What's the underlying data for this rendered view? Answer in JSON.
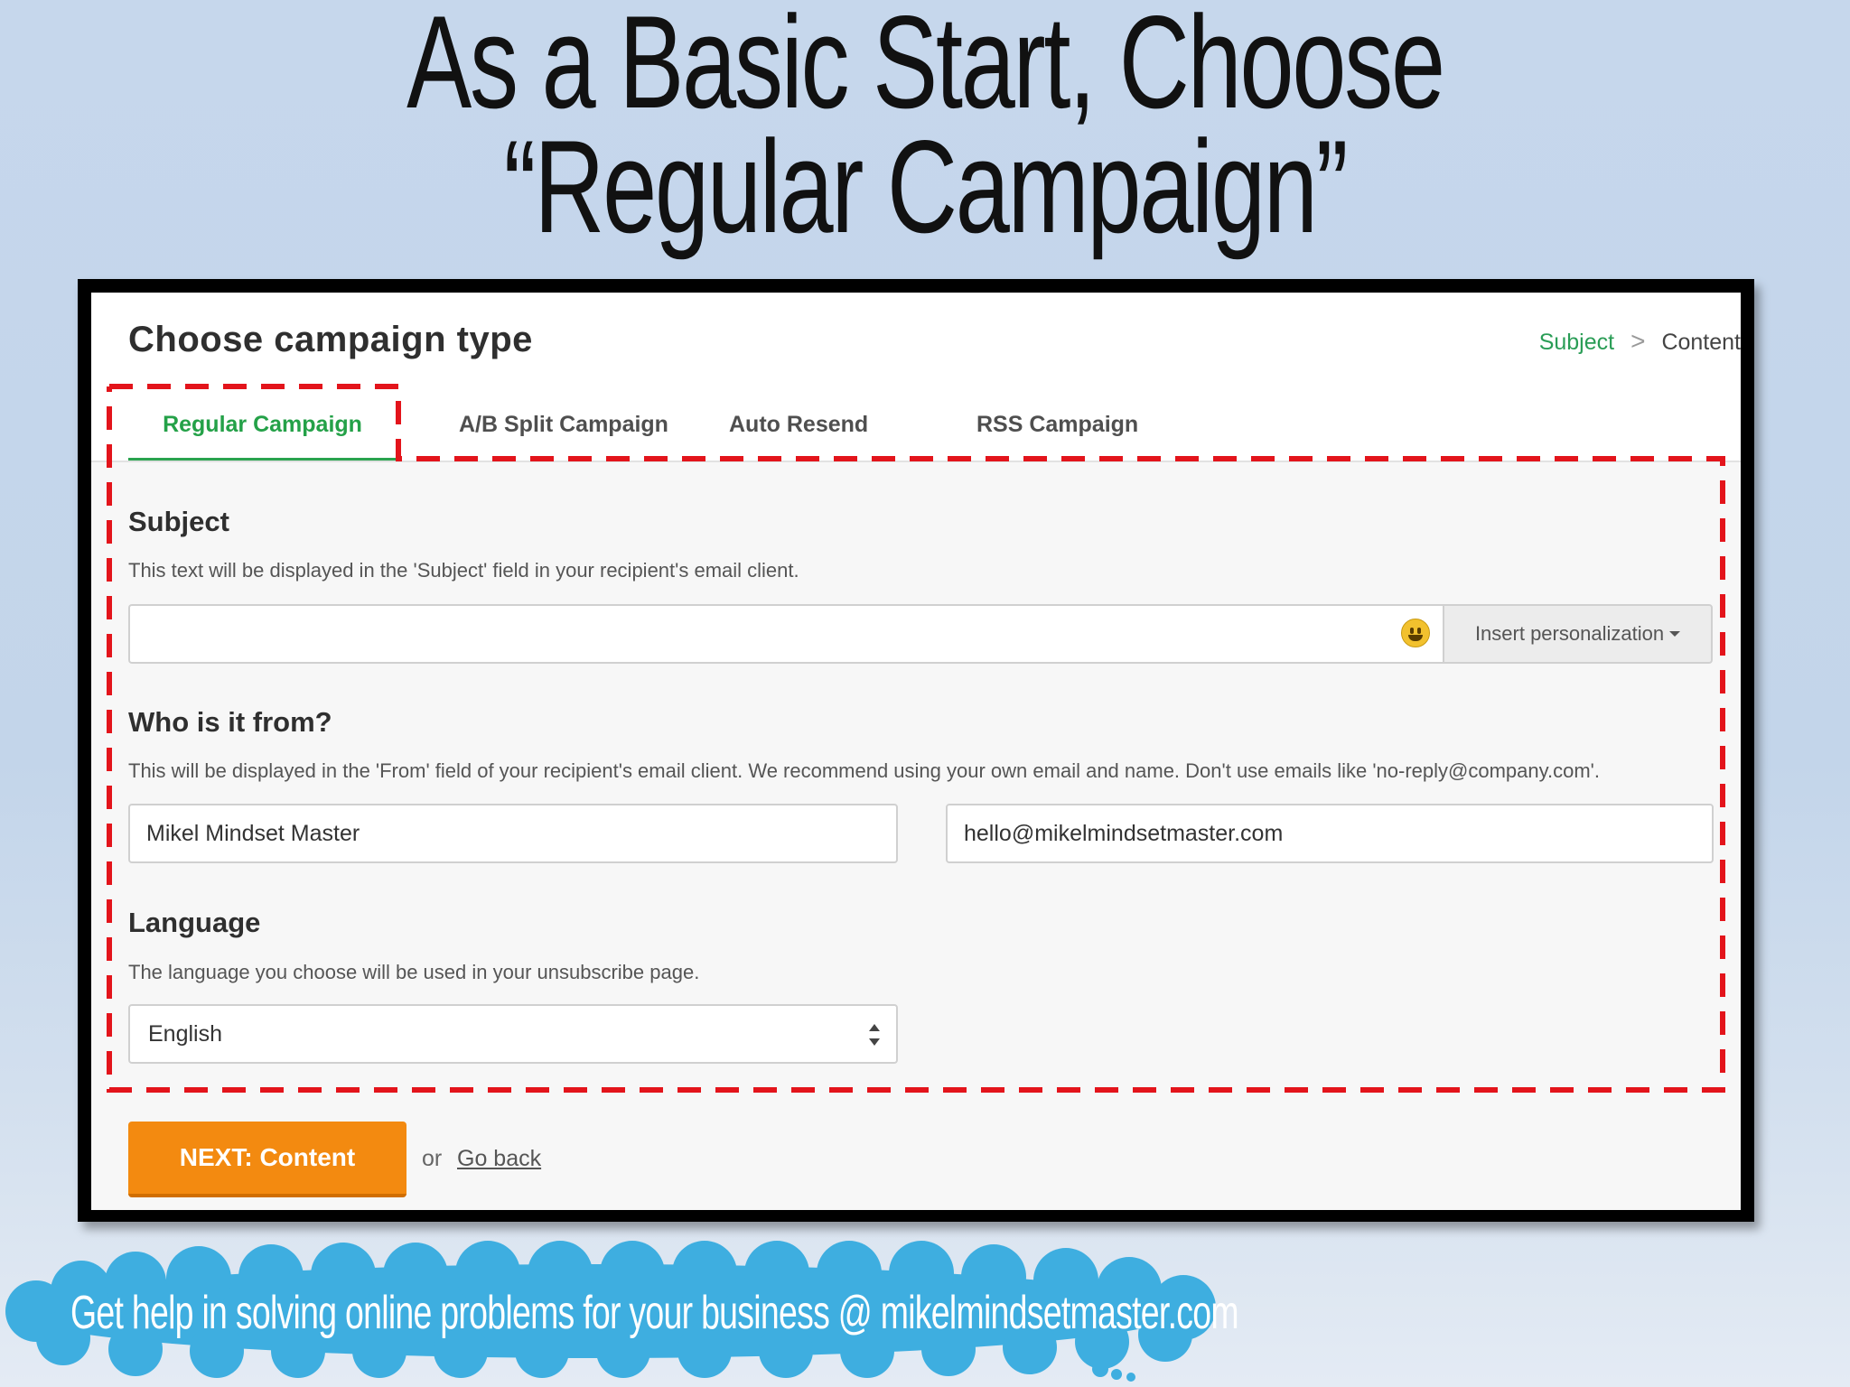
{
  "slide": {
    "title_line1": "As a Basic Start, Choose",
    "title_line2": "“Regular Campaign”",
    "footer": "Get help in solving online problems for your business @ mikelmindsetmaster.com"
  },
  "page": {
    "heading": "Choose campaign type",
    "breadcrumb": {
      "subject": "Subject",
      "separator": ">",
      "content": "Content"
    },
    "tabs": [
      {
        "label": "Regular Campaign",
        "active": true
      },
      {
        "label": "A/B Split Campaign",
        "active": false
      },
      {
        "label": "Auto Resend",
        "active": false
      },
      {
        "label": "RSS Campaign",
        "active": false
      }
    ]
  },
  "subject": {
    "title": "Subject",
    "description": "This text will be displayed in the 'Subject' field in your recipient's email client.",
    "value": "",
    "emoji_icon": "smiley-icon",
    "personalization_label": "Insert personalization"
  },
  "from": {
    "title": "Who is it from?",
    "description": "This will be displayed in the 'From' field of your recipient's email client. We recommend using your own email and name. Don't use emails like 'no-reply@company.com'.",
    "name_value": "Mikel Mindset Master",
    "email_value": "hello@mikelmindsetmaster.com"
  },
  "language": {
    "title": "Language",
    "description": "The language you choose will be used in your unsubscribe page.",
    "selected": "English"
  },
  "actions": {
    "next_label": "NEXT: Content",
    "or_text": "or",
    "go_back_label": "Go back"
  },
  "colors": {
    "accent_green": "#24a148",
    "next_orange": "#f38a10",
    "highlight_red": "#e3141b",
    "cloud_blue": "#3eaee0",
    "frame": "#000000"
  }
}
